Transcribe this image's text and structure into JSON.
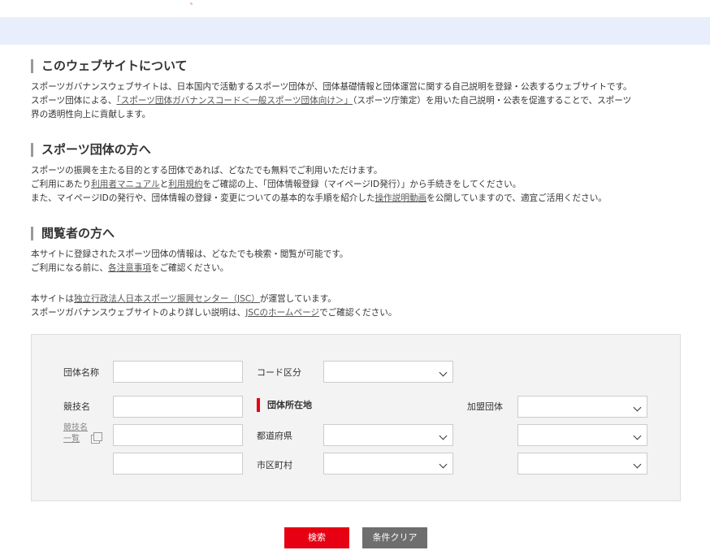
{
  "about": {
    "title": "このウェブサイトについて",
    "line1": "スポーツガバナンスウェブサイトは、日本国内で活動するスポーツ団体が、団体基礎情報と団体運営に関する自己説明を登録・公表するウェブサイトです。",
    "line2_pre": "スポーツ団体による、",
    "line2_link": "「スポーツ団体ガバナンスコード＜一般スポーツ団体向け＞」",
    "line2_post": "（スポーツ庁策定）を用いた自己説明・公表を促進することで、スポーツ",
    "line3": "界の透明性向上に貢献します。"
  },
  "orgs": {
    "title": "スポーツ団体の方へ",
    "line1": "スポーツの振興を主たる目的とする団体であれば、どなたでも無料でご利用いただけます。",
    "line2_pre": "ご利用にあたり",
    "line2_link1": "利用者マニュアル",
    "line2_mid": "と",
    "line2_link2": "利用規約",
    "line2_post": "をご確認の上、「団体情報登録（マイページID発行）」から手続きをしてください。",
    "line3_pre": "また、マイページIDの発行や、団体情報の登録・変更についての基本的な手順を紹介した",
    "line3_link": "操作説明動画",
    "line3_post": "を公開していますので、適宜ご活用ください。"
  },
  "viewers": {
    "title": "閲覧者の方へ",
    "line1": "本サイトに登録されたスポーツ団体の情報は、どなたでも検索・閲覧が可能です。",
    "line2_pre": "ご利用になる前に、",
    "line2_link": "各注意事項",
    "line2_post": "をご確認ください。"
  },
  "operator": {
    "line1_pre": "本サイトは",
    "line1_link": "独立行政法人日本スポーツ振興センター（JSC）",
    "line1_post": "が運営しています。",
    "line2_pre": "スポーツガバナンスウェブサイトのより詳しい説明は、",
    "line2_link": "JSCのホームページ",
    "line2_post": "でご確認ください。"
  },
  "search": {
    "org_name_label": "団体名称",
    "code_label": "コード区分",
    "sport_label": "競技名",
    "sport_list_line1": "競技名",
    "sport_list_line2": "一覧",
    "location_heading": "団体所在地",
    "affiliation_label": "加盟団体",
    "prefecture_label": "都道府県",
    "city_label": "市区町村",
    "search_button": "検索",
    "clear_button": "条件クリア"
  },
  "colors": {
    "accent": "#e60012",
    "band": "#e8eefb",
    "clear_button": "#6e6e6e"
  }
}
